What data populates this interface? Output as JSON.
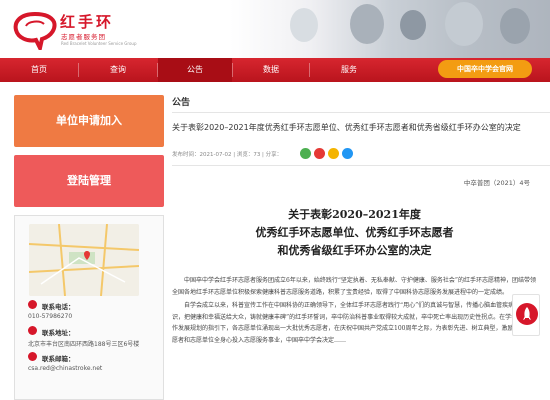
{
  "brand": {
    "title": "红手环",
    "subtitle": "志愿者服务团",
    "english": "Red Bracelet Volunteer Service Group",
    "color": "#d6172a"
  },
  "nav": {
    "items": [
      "首页",
      "查询",
      "公告",
      "数据",
      "服务"
    ],
    "active": "公告",
    "official_button": "中国卒中学会官网"
  },
  "sidebar": {
    "apply_label": "单位申请加入",
    "login_label": "登陆管理",
    "contact": {
      "phone_label": "联系电话：",
      "phone": "010-57986270",
      "address_label": "联系地址：",
      "address": "北京市丰台区南四环西路188号三区6号楼",
      "email_label": "联系邮箱：",
      "email": "csa.red@chinastroke.net"
    }
  },
  "main": {
    "section_title": "公告",
    "article_title": "关于表彰2020–2021年度优秀红手环志愿单位、优秀红手环志愿者和优秀省级红手环办公室的决定",
    "meta": "发布时间：2021-07-02 | 浏览：73 | 分享：",
    "doc_number": "中卒普团（2021）4号",
    "doc_title_lines": [
      "关于表彰2020–2021年度",
      "优秀红手环志愿单位、优秀红手环志愿者",
      "和优秀省级红手环办公室的决定"
    ],
    "body_paragraphs": [
      "中国卒中学会红手环志愿者服务团成立6年以来，始终践行“坚定执着、无私奉献、守护健康、服务社会”的红手环志愿精神，团结带领全国各地红手环志愿单位积极探索健康科普志愿服务道路，积累了宝贵经验，取得了中国科协志愿服务发展进程中的一定成绩。",
      "自学会成立以来，科普宣传工作在中国科协的正确领导下，全体红手环志愿者践行“用心”们的真诚与智慧，传播心脑血管疾病防治知识，把健康和幸福送给大众，铸就健康丰碑”的红手环誓词，卒中防治科普事业取得较大成就，卒中死亡率出现历史性拐点。在学会科普工作发展规划的指引下，各志愿单位涌现出一大批优秀志愿者，在庆祝中国共产党成立100周年之际，为表彰先进、树立典型，激励广大志愿者和志愿单位全身心投入志愿服务事业，中国卒中学会决定……"
    ]
  },
  "colors": {
    "nav_red": "#c31a23",
    "apply_orange": "#ef7a43",
    "login_red": "#ee5a5a",
    "official_orange": "#f39c12"
  },
  "icons": [
    "logo-mark",
    "phone-icon",
    "location-icon",
    "email-icon",
    "wechat-share-icon",
    "weibo-share-icon",
    "qzone-share-icon",
    "more-share-icon",
    "rocket-icon"
  ]
}
